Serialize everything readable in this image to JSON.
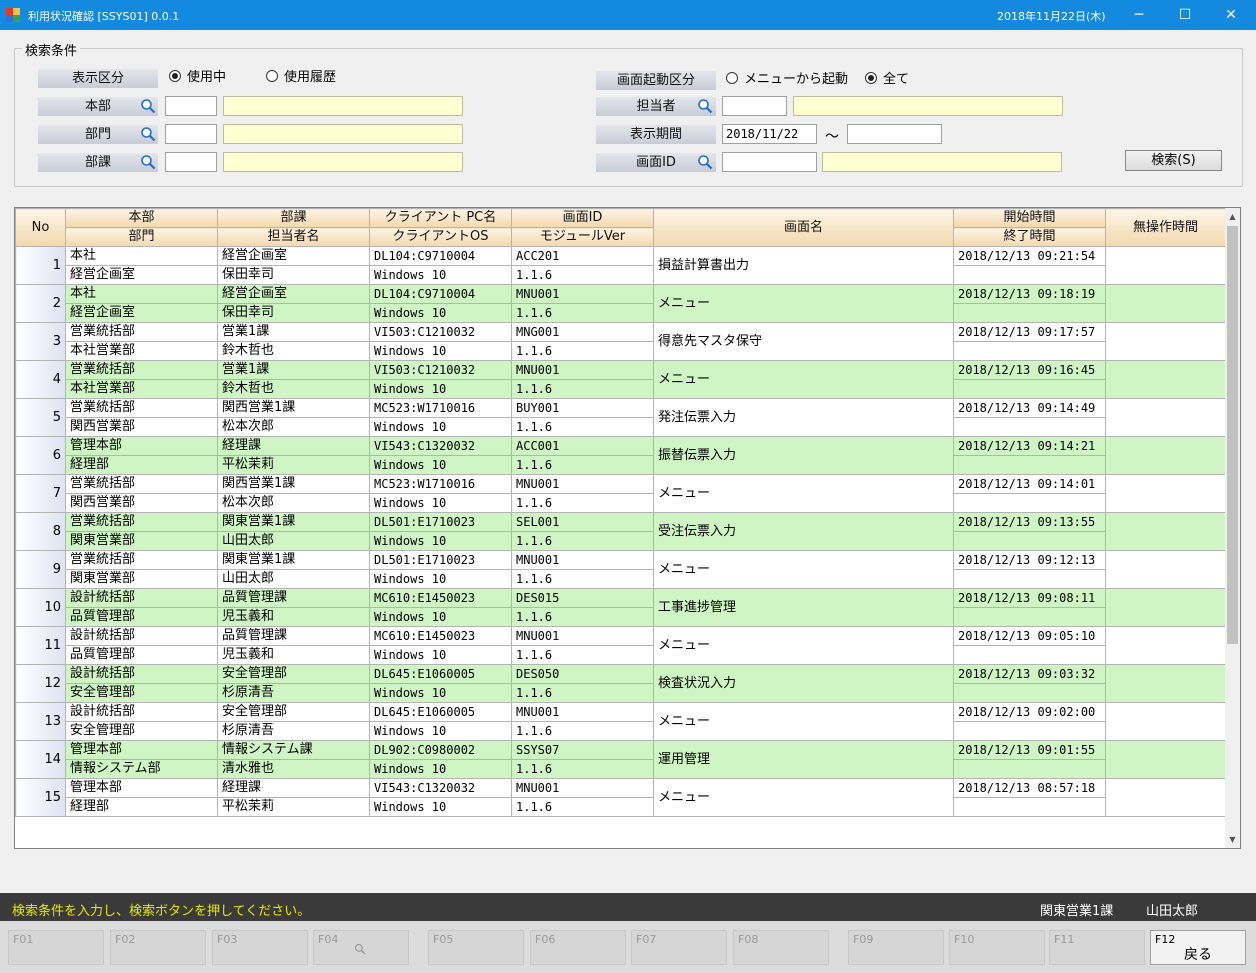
{
  "window": {
    "title": "利用状況確認 [SSYS01]  0.0.1",
    "date": "2018年11月22日(木)",
    "minimize_glyph": "─",
    "maximize_glyph": "☐",
    "close_glyph": "✕"
  },
  "search": {
    "group_label": "検索条件",
    "display_type_label": "表示区分",
    "radio_in_use": "使用中",
    "radio_history": "使用履歴",
    "honbu_label": "本部",
    "bumon_label": "部門",
    "buka_label": "部課",
    "screen_launch_label": "画面起動区分",
    "radio_from_menu": "メニューから起動",
    "radio_all": "全て",
    "tantou_label": "担当者",
    "period_label": "表示期間",
    "period_from": "2018/11/22",
    "period_sep": "～",
    "screen_id_label": "画面ID",
    "search_button": "検索(S)"
  },
  "table": {
    "headers": {
      "no": "No",
      "honbu": "本部",
      "bumon": "部門",
      "buka": "部課",
      "tantou": "担当者名",
      "pc": "クライアント PC名",
      "os": "クライアントOS",
      "screen_id": "画面ID",
      "module_ver": "モジュールVer",
      "screen_name": "画面名",
      "start": "開始時間",
      "end": "終了時間",
      "idle": "無操作時間"
    },
    "rows": [
      {
        "no": "1",
        "honbu": "本社",
        "bumon": "経営企画室",
        "buka": "経営企画室",
        "tantou": "保田幸司",
        "pc": "DL104:C9710004",
        "os": "Windows 10",
        "screen_id": "ACC201",
        "ver": "1.1.6",
        "screen_name": "損益計算書出力",
        "start": "2018/12/13 09:21:54",
        "end": "",
        "idle": ""
      },
      {
        "no": "2",
        "honbu": "本社",
        "bumon": "経営企画室",
        "buka": "経営企画室",
        "tantou": "保田幸司",
        "pc": "DL104:C9710004",
        "os": "Windows 10",
        "screen_id": "MNU001",
        "ver": "1.1.6",
        "screen_name": "メニュー",
        "start": "2018/12/13 09:18:19",
        "end": "",
        "idle": ""
      },
      {
        "no": "3",
        "honbu": "営業統括部",
        "bumon": "本社営業部",
        "buka": "営業1課",
        "tantou": "鈴木哲也",
        "pc": "VI503:C1210032",
        "os": "Windows 10",
        "screen_id": "MNG001",
        "ver": "1.1.6",
        "screen_name": "得意先マスタ保守",
        "start": "2018/12/13 09:17:57",
        "end": "",
        "idle": ""
      },
      {
        "no": "4",
        "honbu": "営業統括部",
        "bumon": "本社営業部",
        "buka": "営業1課",
        "tantou": "鈴木哲也",
        "pc": "VI503:C1210032",
        "os": "Windows 10",
        "screen_id": "MNU001",
        "ver": "1.1.6",
        "screen_name": "メニュー",
        "start": "2018/12/13 09:16:45",
        "end": "",
        "idle": ""
      },
      {
        "no": "5",
        "honbu": "営業統括部",
        "bumon": "関西営業部",
        "buka": "関西営業1課",
        "tantou": "松本次郎",
        "pc": "MC523:W1710016",
        "os": "Windows 10",
        "screen_id": "BUY001",
        "ver": "1.1.6",
        "screen_name": "発注伝票入力",
        "start": "2018/12/13 09:14:49",
        "end": "",
        "idle": ""
      },
      {
        "no": "6",
        "honbu": "管理本部",
        "bumon": "経理部",
        "buka": "経理課",
        "tantou": "平松茉莉",
        "pc": "VI543:C1320032",
        "os": "Windows 10",
        "screen_id": "ACC001",
        "ver": "1.1.6",
        "screen_name": "振替伝票入力",
        "start": "2018/12/13 09:14:21",
        "end": "",
        "idle": ""
      },
      {
        "no": "7",
        "honbu": "営業統括部",
        "bumon": "関西営業部",
        "buka": "関西営業1課",
        "tantou": "松本次郎",
        "pc": "MC523:W1710016",
        "os": "Windows 10",
        "screen_id": "MNU001",
        "ver": "1.1.6",
        "screen_name": "メニュー",
        "start": "2018/12/13 09:14:01",
        "end": "",
        "idle": ""
      },
      {
        "no": "8",
        "honbu": "営業統括部",
        "bumon": "関東営業部",
        "buka": "関東営業1課",
        "tantou": "山田太郎",
        "pc": "DL501:E1710023",
        "os": "Windows 10",
        "screen_id": "SEL001",
        "ver": "1.1.6",
        "screen_name": "受注伝票入力",
        "start": "2018/12/13 09:13:55",
        "end": "",
        "idle": ""
      },
      {
        "no": "9",
        "honbu": "営業統括部",
        "bumon": "関東営業部",
        "buka": "関東営業1課",
        "tantou": "山田太郎",
        "pc": "DL501:E1710023",
        "os": "Windows 10",
        "screen_id": "MNU001",
        "ver": "1.1.6",
        "screen_name": "メニュー",
        "start": "2018/12/13 09:12:13",
        "end": "",
        "idle": ""
      },
      {
        "no": "10",
        "honbu": "設計統括部",
        "bumon": "品質管理部",
        "buka": "品質管理課",
        "tantou": "児玉義和",
        "pc": "MC610:E1450023",
        "os": "Windows 10",
        "screen_id": "DES015",
        "ver": "1.1.6",
        "screen_name": "工事進捗管理",
        "start": "2018/12/13 09:08:11",
        "end": "",
        "idle": ""
      },
      {
        "no": "11",
        "honbu": "設計統括部",
        "bumon": "品質管理部",
        "buka": "品質管理課",
        "tantou": "児玉義和",
        "pc": "MC610:E1450023",
        "os": "Windows 10",
        "screen_id": "MNU001",
        "ver": "1.1.6",
        "screen_name": "メニュー",
        "start": "2018/12/13 09:05:10",
        "end": "",
        "idle": ""
      },
      {
        "no": "12",
        "honbu": "設計統括部",
        "bumon": "安全管理部",
        "buka": "安全管理部",
        "tantou": "杉原清吾",
        "pc": "DL645:E1060005",
        "os": "Windows 10",
        "screen_id": "DES050",
        "ver": "1.1.6",
        "screen_name": "検査状況入力",
        "start": "2018/12/13 09:03:32",
        "end": "",
        "idle": ""
      },
      {
        "no": "13",
        "honbu": "設計統括部",
        "bumon": "安全管理部",
        "buka": "安全管理部",
        "tantou": "杉原清吾",
        "pc": "DL645:E1060005",
        "os": "Windows 10",
        "screen_id": "MNU001",
        "ver": "1.1.6",
        "screen_name": "メニュー",
        "start": "2018/12/13 09:02:00",
        "end": "",
        "idle": ""
      },
      {
        "no": "14",
        "honbu": "管理本部",
        "bumon": "情報システム部",
        "buka": "情報システム課",
        "tantou": "清水雅也",
        "pc": "DL902:C0980002",
        "os": "Windows 10",
        "screen_id": "SSYS07",
        "ver": "1.1.6",
        "screen_name": "運用管理",
        "start": "2018/12/13 09:01:55",
        "end": "",
        "idle": ""
      },
      {
        "no": "15",
        "honbu": "管理本部",
        "bumon": "経理部",
        "buka": "経理課",
        "tantou": "平松茉莉",
        "pc": "VI543:C1320032",
        "os": "Windows 10",
        "screen_id": "MNU001",
        "ver": "1.1.6",
        "screen_name": "メニュー",
        "start": "2018/12/13 08:57:18",
        "end": "",
        "idle": ""
      }
    ],
    "scroll_up_glyph": "▲",
    "scroll_down_glyph": "▼"
  },
  "status": {
    "message": "検索条件を入力し、検索ボタンを押してください。",
    "department": "関東営業1課",
    "user": "山田太郎"
  },
  "fkeys": [
    {
      "key": "F01",
      "label": ""
    },
    {
      "key": "F02",
      "label": ""
    },
    {
      "key": "F03",
      "label": ""
    },
    {
      "key": "F04",
      "label": ""
    },
    {
      "key": "F05",
      "label": ""
    },
    {
      "key": "F06",
      "label": ""
    },
    {
      "key": "F07",
      "label": ""
    },
    {
      "key": "F08",
      "label": ""
    },
    {
      "key": "F09",
      "label": ""
    },
    {
      "key": "F10",
      "label": ""
    },
    {
      "key": "F11",
      "label": ""
    },
    {
      "key": "F12",
      "label": "戻る"
    }
  ],
  "colors": {
    "titlebar": "#1489e0",
    "row_alt": "#cff5c4",
    "status_message": "#e8e800",
    "input_yellow": "#ffffd2"
  },
  "icons": {
    "app": "app-grid-icon",
    "lookup": "magnifier-icon",
    "f04": "magnifier-icon"
  }
}
